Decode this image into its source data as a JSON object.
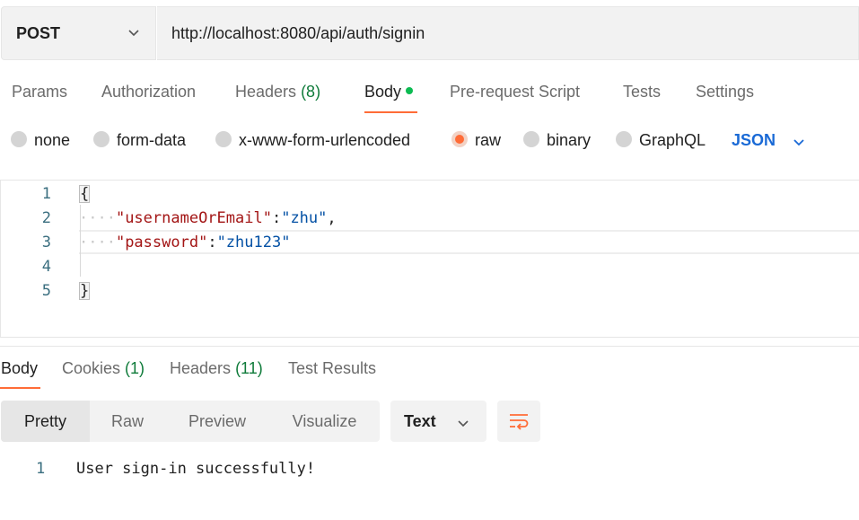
{
  "request": {
    "method": "POST",
    "url": "http://localhost:8080/api/auth/signin"
  },
  "request_tabs": {
    "params": "Params",
    "authorization": "Authorization",
    "headers": "Headers",
    "headers_count": "(8)",
    "body": "Body",
    "prerequest": "Pre-request Script",
    "tests": "Tests",
    "settings": "Settings"
  },
  "body_types": {
    "none": "none",
    "form_data": "form-data",
    "urlencoded": "x-www-form-urlencoded",
    "raw": "raw",
    "binary": "binary",
    "graphql": "GraphQL",
    "selected": "raw",
    "format": "JSON"
  },
  "editor": {
    "line_numbers": [
      "1",
      "2",
      "3",
      "4",
      "5"
    ],
    "open_brace": "{",
    "close_brace": "}",
    "indent": "····",
    "key1": "\"usernameOrEmail\"",
    "val1": "\"zhu\"",
    "key2": "\"password\"",
    "val2": "\"zhu123\"",
    "colon": ":",
    "comma": ","
  },
  "response_tabs": {
    "body": "Body",
    "cookies": "Cookies",
    "cookies_count": "(1)",
    "headers": "Headers",
    "headers_count": "(11)",
    "test_results": "Test Results"
  },
  "view_modes": {
    "pretty": "Pretty",
    "raw": "Raw",
    "preview": "Preview",
    "visualize": "Visualize",
    "selected": "Pretty"
  },
  "response_format": "Text",
  "response": {
    "line_number": "1",
    "text": "User sign-in successfully!"
  },
  "colors": {
    "accent": "#ff6c37",
    "json_blue": "#1a6ad6",
    "count_green": "#0f7b3a",
    "dot_green": "#0cbb52"
  }
}
